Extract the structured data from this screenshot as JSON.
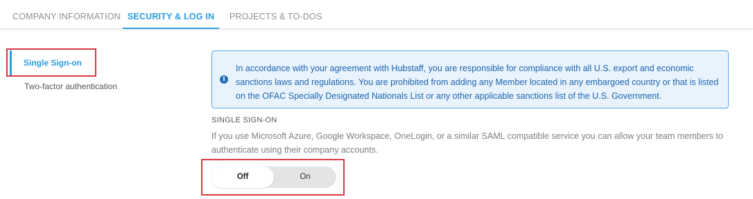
{
  "tabs": [
    {
      "label": "COMPANY INFORMATION",
      "active": false
    },
    {
      "label": "SECURITY & LOG IN",
      "active": true
    },
    {
      "label": "PROJECTS & TO-DOS",
      "active": false
    }
  ],
  "sidebar": {
    "items": [
      {
        "label": "Single Sign-on",
        "active": true
      },
      {
        "label": "Two-factor authentication",
        "active": false
      }
    ]
  },
  "notice": {
    "icon": "info-icon",
    "text": "In accordance with your agreement with Hubstaff, you are responsible for compliance with all U.S. export and economic sanctions laws and regulations. You are prohibited from adding any Member located in any embargoed country or that is listed on the OFAC Specially Designated Nationals List or any other applicable sanctions list of the U.S. Government."
  },
  "sso": {
    "title": "SINGLE SIGN-ON",
    "description": "If you use Microsoft Azure, Google Workspace, OneLogin, or a similar SAML compatible service you can allow your team members to authenticate using their company accounts.",
    "toggle": {
      "off_label": "Off",
      "on_label": "On",
      "selected": "Off"
    }
  },
  "colors": {
    "accent": "#2b9de0",
    "highlight_box": "#d9373f",
    "notice_bg": "#e9f3fd",
    "notice_text": "#1d64ad"
  }
}
